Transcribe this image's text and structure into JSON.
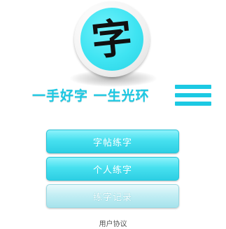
{
  "logo": {
    "char": "字",
    "icon": "calligraphy-logo-icon"
  },
  "slogan": "一手好字 一生光环",
  "menu_icon": "hamburger-menu-icon",
  "buttons": {
    "copybook_practice": "字帖练字",
    "personal_practice": "个人练字",
    "practice_record": "练字记录"
  },
  "footer": {
    "agreement": "用户协议"
  },
  "colors": {
    "accent": "#1cc9e3",
    "button_primary": "#47e0ef",
    "button_secondary": "#c3eef4"
  }
}
